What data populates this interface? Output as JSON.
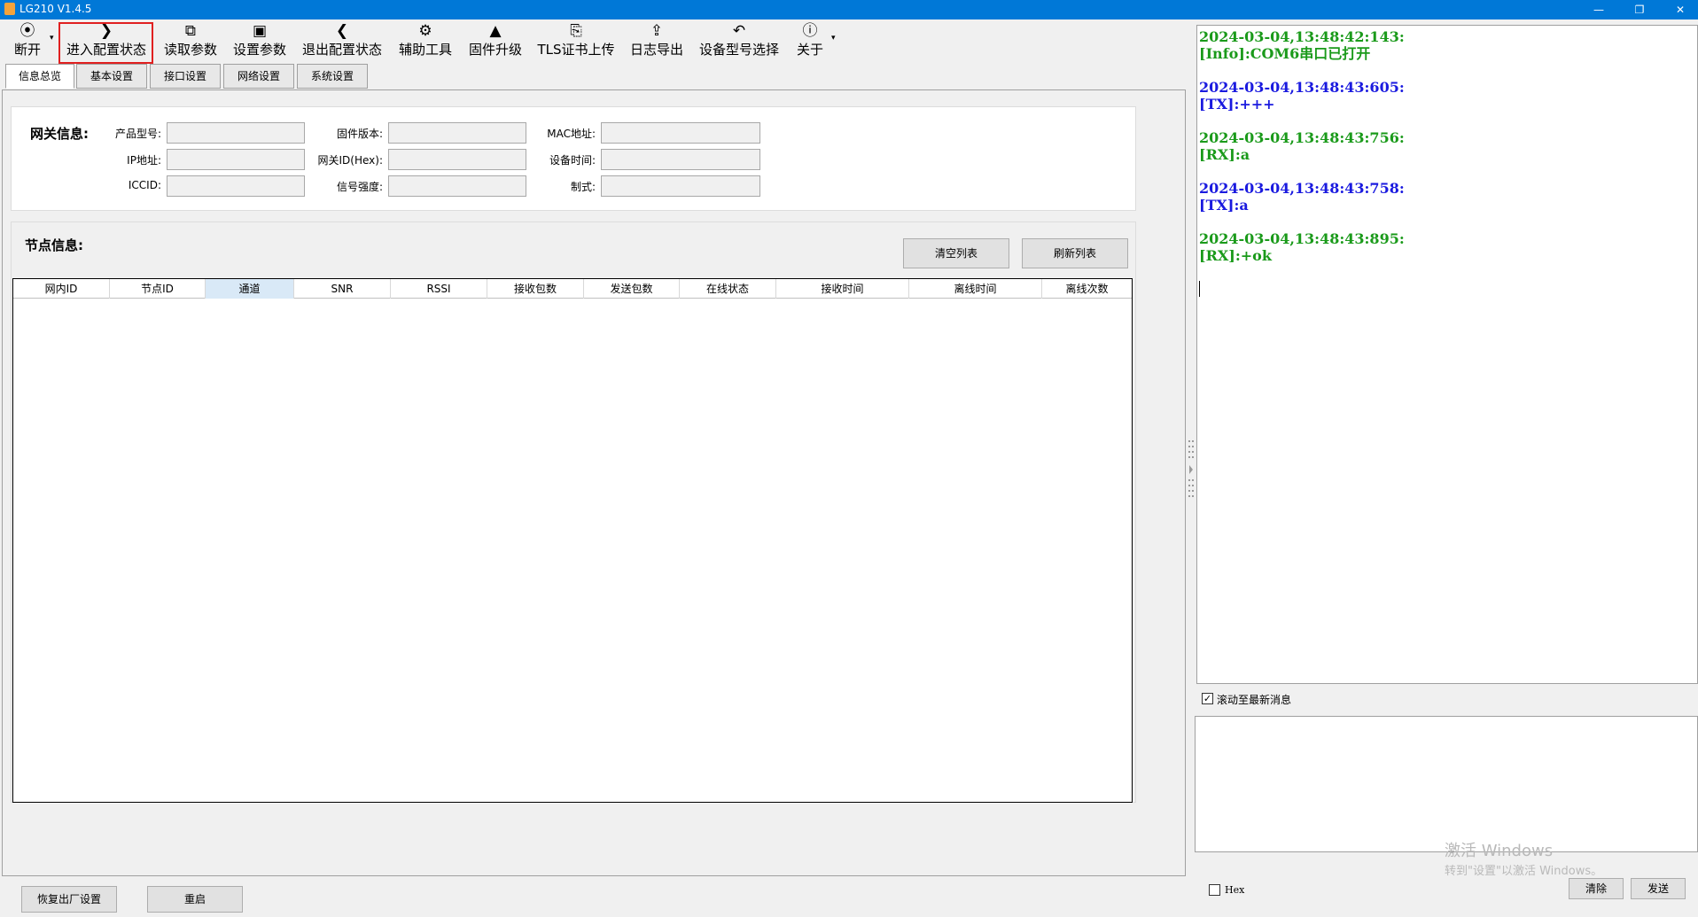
{
  "window": {
    "title": "LG210 V1.4.5",
    "controls": {
      "minimize": "—",
      "restore": "❐",
      "close": "✕"
    }
  },
  "toolbar": {
    "items": [
      {
        "label": "断开",
        "icon": "location-pin-icon",
        "glyph": "⦿"
      },
      {
        "label": "进入配置状态",
        "icon": "chevron-right-icon",
        "glyph": "❯"
      },
      {
        "label": "读取参数",
        "icon": "read-doc-icon",
        "glyph": "⧉"
      },
      {
        "label": "设置参数",
        "icon": "save-icon",
        "glyph": "▣"
      },
      {
        "label": "退出配置状态",
        "icon": "chevron-left-icon",
        "glyph": "❮"
      },
      {
        "label": "辅助工具",
        "icon": "toolbox-icon",
        "glyph": "⚙"
      },
      {
        "label": "固件升级",
        "icon": "rocket-icon",
        "glyph": "▲"
      },
      {
        "label": "TLS证书上传",
        "icon": "certificate-icon",
        "glyph": "⎘"
      },
      {
        "label": "日志导出",
        "icon": "export-icon",
        "glyph": "⇪"
      },
      {
        "label": "设备型号选择",
        "icon": "reply-arrow-icon",
        "glyph": "↶"
      },
      {
        "label": "关于",
        "icon": "info-icon",
        "glyph": "ⓘ"
      }
    ],
    "dropdown_glyph": "▾"
  },
  "tabs": [
    "信息总览",
    "基本设置",
    "接口设置",
    "网络设置",
    "系统设置"
  ],
  "gateway": {
    "section_title": "网关信息:",
    "fields": {
      "product_model": {
        "label": "产品型号:",
        "value": ""
      },
      "ip_address": {
        "label": "IP地址:",
        "value": ""
      },
      "iccid": {
        "label": "ICCID:",
        "value": ""
      },
      "firmware_version": {
        "label": "固件版本:",
        "value": ""
      },
      "gateway_id": {
        "label": "网关ID(Hex):",
        "value": ""
      },
      "signal_strength": {
        "label": "信号强度:",
        "value": ""
      },
      "mac_address": {
        "label": "MAC地址:",
        "value": ""
      },
      "device_time": {
        "label": "设备时间:",
        "value": ""
      },
      "standard": {
        "label": "制式:",
        "value": ""
      }
    }
  },
  "nodes": {
    "section_title": "节点信息:",
    "clear_button": "清空列表",
    "refresh_button": "刷新列表",
    "columns": [
      "网内ID",
      "节点ID",
      "通道",
      "SNR",
      "RSSI",
      "接收包数",
      "发送包数",
      "在线状态",
      "接收时间",
      "离线时间",
      "离线次数"
    ],
    "rows": []
  },
  "bottom": {
    "factory_reset": "恢复出厂设置",
    "restart": "重启"
  },
  "log": {
    "entries": [
      {
        "time": "2024-03-04,13:48:42:143:",
        "msg": "[Info]:COM6串口已打开",
        "color": "green"
      },
      {
        "time": "2024-03-04,13:48:43:605:",
        "msg": "[TX]:+++",
        "color": "blue"
      },
      {
        "time": "2024-03-04,13:48:43:756:",
        "msg": "[RX]:a",
        "color": "green"
      },
      {
        "time": "2024-03-04,13:48:43:758:",
        "msg": "[TX]:a",
        "color": "blue"
      },
      {
        "time": "2024-03-04,13:48:43:895:",
        "msg": "[RX]:+ok",
        "color": "green"
      }
    ],
    "scroll_latest_label": "滚动至最新消息",
    "scroll_latest_checked": true
  },
  "send": {
    "hex_label": "Hex",
    "hex_checked": false,
    "clear_button": "清除",
    "send_button": "发送",
    "input_value": ""
  },
  "watermark": {
    "line1": "激活 Windows",
    "line2": "转到\"设置\"以激活 Windows。"
  },
  "colors": {
    "titlebar": "#0078d7",
    "log_green": "#1a9a1a",
    "log_blue": "#1a1adf",
    "highlight_red": "#e02020",
    "selected_column": "#d9e9f7"
  }
}
